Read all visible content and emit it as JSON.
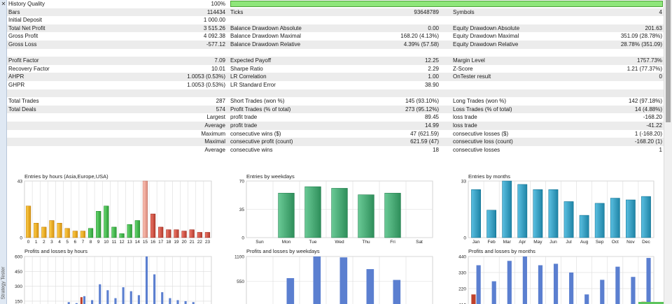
{
  "strip": {
    "close_glyph": "✕",
    "vertical_label": "Strategy Tester"
  },
  "report": {
    "history_quality": {
      "label": "History Quality",
      "value": "100%",
      "bar_fill": 1.0
    },
    "rows": [
      {
        "alt": true,
        "c": [
          "Bars",
          "114434",
          "Ticks",
          "93648789",
          "Symbols",
          "4"
        ]
      },
      {
        "alt": false,
        "c": [
          "Initial Deposit",
          "1 000.00",
          "",
          "",
          "",
          ""
        ]
      },
      {
        "alt": true,
        "c": [
          "Total Net Profit",
          "3 515.26",
          "Balance Drawdown Absolute",
          "0.00",
          "Equity Drawdown Absolute",
          "201.63"
        ]
      },
      {
        "alt": false,
        "c": [
          "Gross Profit",
          "4 092.38",
          "Balance Drawdown Maximal",
          "168.20 (4.13%)",
          "Equity Drawdown Maximal",
          "351.09 (28.78%)"
        ]
      },
      {
        "alt": true,
        "c": [
          "Gross Loss",
          "-577.12",
          "Balance Drawdown Relative",
          "4.39% (57.58)",
          "Equity Drawdown Relative",
          "28.78% (351.09)"
        ]
      },
      {
        "alt": false,
        "c": [
          "",
          "",
          "",
          "",
          "",
          ""
        ]
      },
      {
        "alt": true,
        "c": [
          "Profit Factor",
          "7.09",
          "Expected Payoff",
          "12.25",
          "Margin Level",
          "1757.73%"
        ]
      },
      {
        "alt": false,
        "c": [
          "Recovery Factor",
          "10.01",
          "Sharpe Ratio",
          "2.29",
          "Z-Score",
          "1.21 (77.37%)"
        ]
      },
      {
        "alt": true,
        "c": [
          "AHPR",
          "1.0053 (0.53%)",
          "LR Correlation",
          "1.00",
          "OnTester result",
          "0"
        ]
      },
      {
        "alt": false,
        "c": [
          "GHPR",
          "1.0053 (0.53%)",
          "LR Standard Error",
          "38.90",
          "",
          ""
        ]
      },
      {
        "alt": true,
        "c": [
          "",
          "",
          "",
          "",
          "",
          ""
        ]
      },
      {
        "alt": false,
        "c": [
          "Total Trades",
          "287",
          "Short Trades (won %)",
          "145 (93.10%)",
          "Long Trades (won %)",
          "142 (97.18%)"
        ]
      },
      {
        "alt": true,
        "c": [
          "Total Deals",
          "574",
          "Profit Trades (% of total)",
          "273 (95.12%)",
          "Loss Trades (% of total)",
          "14 (4.88%)"
        ]
      },
      {
        "alt": false,
        "c": [
          "",
          "Largest",
          "profit trade",
          "89.45",
          "loss trade",
          "-168.20"
        ]
      },
      {
        "alt": true,
        "c": [
          "",
          "Average",
          "profit trade",
          "14.99",
          "loss trade",
          "-41.22"
        ]
      },
      {
        "alt": false,
        "c": [
          "",
          "Maximum",
          "consecutive wins ($)",
          "47 (621.59)",
          "consecutive losses ($)",
          "1 (-168.20)"
        ]
      },
      {
        "alt": true,
        "c": [
          "",
          "Maximal",
          "consecutive profit (count)",
          "621.59 (47)",
          "consecutive loss (count)",
          "-168.20 (1)"
        ]
      },
      {
        "alt": false,
        "c": [
          "",
          "Average",
          "consecutive wins",
          "18",
          "consecutive losses",
          "1"
        ]
      }
    ]
  },
  "chart_data": [
    {
      "type": "bar",
      "title": "Entries by hours (Asia,Europe,USA)",
      "categories": [
        "0",
        "1",
        "2",
        "3",
        "4",
        "5",
        "6",
        "7",
        "8",
        "9",
        "10",
        "11",
        "12",
        "13",
        "14",
        "15",
        "16",
        "17",
        "18",
        "19",
        "20",
        "21",
        "22",
        "23"
      ],
      "values": [
        24,
        11,
        8,
        13,
        11,
        7,
        5,
        5,
        7,
        20,
        24,
        8,
        3,
        10,
        13,
        43,
        18,
        8,
        6,
        6,
        5,
        6,
        4,
        4
      ],
      "colors": [
        "#d6930f",
        "#d6930f",
        "#d6930f",
        "#d6930f",
        "#d6930f",
        "#d6930f",
        "#d6930f",
        "#d6930f",
        "#2e9d37",
        "#2e9d37",
        "#2e9d37",
        "#2e9d37",
        "#2e9d37",
        "#2e9d37",
        "#2e9d37",
        "#d98a7c",
        "#b43c2e",
        "#b43c2e",
        "#b43c2e",
        "#b43c2e",
        "#b43c2e",
        "#b43c2e",
        "#b43c2e",
        "#b43c2e"
      ],
      "yticks": [
        0,
        43
      ],
      "ylim": [
        0,
        43
      ]
    },
    {
      "type": "bar",
      "title": "Entries by weekdays",
      "categories": [
        "Sun",
        "Mon",
        "Tue",
        "Wed",
        "Thu",
        "Fri",
        "Sat"
      ],
      "values": [
        0,
        55,
        63,
        61,
        53,
        55,
        0
      ],
      "color": "#2e8e5a",
      "yticks": [
        0,
        35,
        70
      ],
      "ylim": [
        0,
        70
      ]
    },
    {
      "type": "bar",
      "title": "Entries by months",
      "categories": [
        "Jan",
        "Feb",
        "Mar",
        "Apr",
        "May",
        "Jun",
        "Jul",
        "Aug",
        "Sep",
        "Oct",
        "Nov",
        "Dec"
      ],
      "values": [
        28,
        16,
        33,
        31,
        28,
        28,
        21,
        13,
        20,
        23,
        22,
        24
      ],
      "color": "#1f84a6",
      "yticks": [
        0,
        33
      ],
      "ylim": [
        0,
        33
      ]
    },
    {
      "type": "bar",
      "title": "Profits and losses by hours",
      "categories": [
        "0",
        "1",
        "2",
        "3",
        "4",
        "5",
        "6",
        "7",
        "8",
        "9",
        "10",
        "11",
        "12",
        "13",
        "14",
        "15",
        "16",
        "17",
        "18",
        "19",
        "20",
        "21",
        "22",
        "23"
      ],
      "profits": [
        60,
        80,
        70,
        100,
        120,
        140,
        130,
        200,
        160,
        320,
        260,
        180,
        290,
        250,
        210,
        600,
        420,
        240,
        180,
        160,
        150,
        140,
        120,
        110
      ],
      "losses": [
        0,
        0,
        0,
        0,
        0,
        0,
        0,
        190,
        0,
        0,
        0,
        0,
        0,
        0,
        0,
        0,
        0,
        0,
        0,
        0,
        0,
        0,
        0,
        0
      ],
      "yticks": [
        150,
        300,
        450,
        600
      ],
      "ylim": [
        100,
        600
      ]
    },
    {
      "type": "bar",
      "title": "Profits and losses by weekdays",
      "categories": [
        "Sun",
        "Mon",
        "Tue",
        "Wed",
        "Thu",
        "Fri",
        "Sat"
      ],
      "profits": [
        0,
        620,
        1100,
        1080,
        820,
        580,
        0
      ],
      "losses": [
        0,
        0,
        0,
        0,
        0,
        0,
        0
      ],
      "yticks": [
        550,
        1100
      ],
      "ylim": [
        0,
        1100
      ]
    },
    {
      "type": "bar",
      "title": "Profits and losses by months",
      "categories": [
        "Jan",
        "Feb",
        "Mar",
        "Apr",
        "May",
        "Jun",
        "Jul",
        "Aug",
        "Sep",
        "Oct",
        "Nov",
        "Dec"
      ],
      "profits": [
        380,
        270,
        410,
        440,
        380,
        390,
        330,
        180,
        280,
        370,
        300,
        430
      ],
      "losses": [
        180,
        0,
        0,
        0,
        0,
        0,
        0,
        0,
        0,
        0,
        0,
        130
      ],
      "yticks": [
        110,
        220,
        330,
        440
      ],
      "ylim": [
        100,
        440
      ]
    }
  ],
  "colors": {
    "profit": "#5b7fd0",
    "loss": "#c0422c",
    "quality": "#8ee67a"
  }
}
